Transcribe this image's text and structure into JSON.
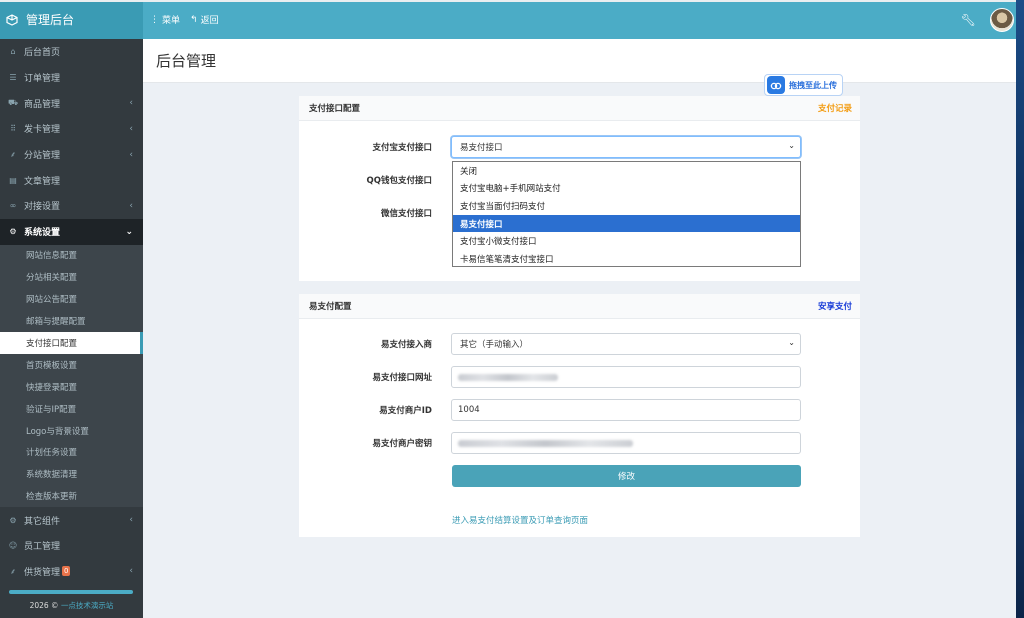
{
  "header": {
    "brand": "管理后台",
    "menu_label": "菜单",
    "back_label": "返回"
  },
  "sidebar": {
    "items": [
      {
        "label": "后台首页",
        "icon": "home-icon",
        "glyph": "⌂"
      },
      {
        "label": "订单管理",
        "icon": "list-icon",
        "glyph": "☰"
      },
      {
        "label": "商品管理",
        "icon": "cart-icon",
        "glyph": "⛟"
      },
      {
        "label": "发卡管理",
        "icon": "grid-icon",
        "glyph": "⋮"
      },
      {
        "label": "分站管理",
        "icon": "sitemap-icon",
        "glyph": "⸙"
      },
      {
        "label": "文章管理",
        "icon": "book-icon",
        "glyph": "▤"
      },
      {
        "label": "对接设置",
        "icon": "link-icon",
        "glyph": "∞"
      },
      {
        "label": "系统设置",
        "icon": "gear-icon",
        "glyph": "⚙"
      }
    ],
    "submenu": [
      "网站信息配置",
      "分站相关配置",
      "网站公告配置",
      "邮箱与提醒配置",
      "支付接口配置",
      "首页模板设置",
      "快捷登录配置",
      "验证与IP配置",
      "Logo与背景设置",
      "计划任务设置",
      "系统数据清理",
      "检查版本更新"
    ],
    "bottom_items": [
      {
        "label": "其它组件",
        "icon": "cogs-icon",
        "glyph": "⚙"
      },
      {
        "label": "员工管理",
        "icon": "user-icon",
        "glyph": "☺"
      },
      {
        "label": "供货管理",
        "icon": "supply-icon",
        "glyph": "⸙",
        "badge": "0"
      }
    ],
    "footer_year": "2026 ©",
    "footer_link": "一点技术演示站"
  },
  "page": {
    "title": "后台管理",
    "upload_label": "拖拽至此上传"
  },
  "panel1": {
    "title": "支付接口配置",
    "right_link": "支付记录",
    "right_link_color": "#f39c12",
    "alipay_label": "支付宝支付接口",
    "alipay_value": "易支付接口",
    "qq_label": "QQ钱包支付接口",
    "wechat_label": "微信支付接口",
    "options": [
      "关闭",
      "支付宝电脑+手机网站支付",
      "支付宝当面付扫码支付",
      "易支付接口",
      "支付宝小微支付接口",
      "卡易信笔笔清支付宝接口"
    ],
    "selected_option": "易支付接口"
  },
  "panel2": {
    "title": "易支付配置",
    "right_link": "安享支付",
    "right_link_color": "#1a3ed8",
    "provider_label": "易支付接入商",
    "provider_value": "其它（手动输入）",
    "url_label": "易支付接口网址",
    "merchant_id_label": "易支付商户ID",
    "merchant_id_value": "1004",
    "merchant_key_label": "易支付商户密钥",
    "submit_label": "修改",
    "settle_link": "进入易支付结算设置及订单查询页面"
  }
}
